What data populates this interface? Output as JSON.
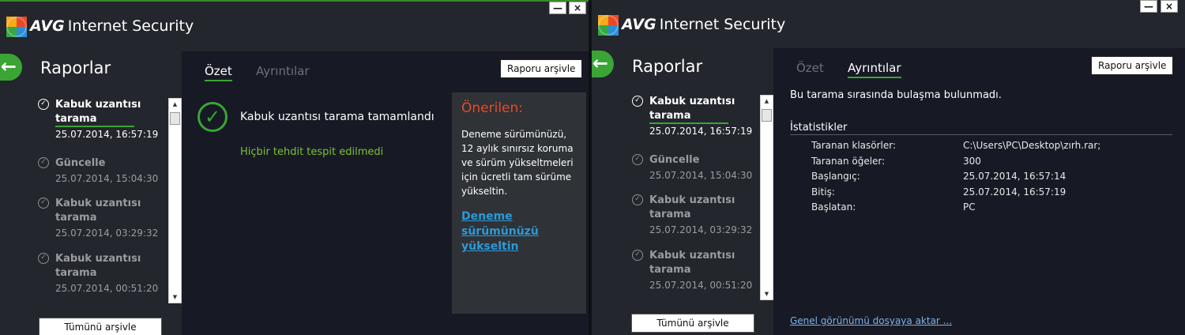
{
  "app": {
    "brand": "AVG",
    "product": "Internet Security",
    "minimize_label": "—",
    "close_label": "×"
  },
  "colors": {
    "accent_green": "#3aa535",
    "warning_red": "#e84a27",
    "link_blue": "#2c9ad6"
  },
  "icons": {
    "back": "arrow-left",
    "report_status": "check-circle",
    "scan_result": "check-circle-large"
  },
  "sidebar": {
    "title": "Raporlar",
    "archive_all_label": "Tümünü arşivle",
    "reports": [
      {
        "name": "Kabuk uzantısı tarama",
        "date": "25.07.2014, 16:57:19"
      },
      {
        "name": "Güncelle",
        "date": "25.07.2014, 15:04:30"
      },
      {
        "name": "Kabuk uzantısı tarama",
        "date": "25.07.2014, 03:29:32"
      },
      {
        "name": "Kabuk uzantısı tarama",
        "date": "25.07.2014, 00:51:20"
      }
    ]
  },
  "tabs": {
    "summary": "Özet",
    "details": "Ayrıntılar"
  },
  "archive_report_label": "Raporu arşivle",
  "summary": {
    "title": "Kabuk uzantısı tarama tamamlandı",
    "status": "Hiçbir tehdit tespit edilmedi",
    "recommended": {
      "title": "Önerilen:",
      "text": "Deneme sürümünüzü, 12 aylık sınırsız koruma ve sürüm yükseltmeleri için ücretli tam sürüme yükseltin.",
      "link": "Deneme sürümünüzü yükseltin"
    }
  },
  "details": {
    "message": "Bu tarama sırasında bulaşma bulunmadı.",
    "stats_heading": "İstatistikler",
    "stats": [
      {
        "label": "Taranan klasörler:",
        "value": "C:\\Users\\PC\\Desktop\\zırh.rar;"
      },
      {
        "label": "Taranan öğeler:",
        "value": "300"
      },
      {
        "label": "Başlangıç:",
        "value": "25.07.2014, 16:57:14"
      },
      {
        "label": "Bitiş:",
        "value": "25.07.2014, 16:57:19"
      },
      {
        "label": "Başlatan:",
        "value": "PC"
      }
    ],
    "export_link": "Genel görünümü dosyaya aktar ..."
  }
}
